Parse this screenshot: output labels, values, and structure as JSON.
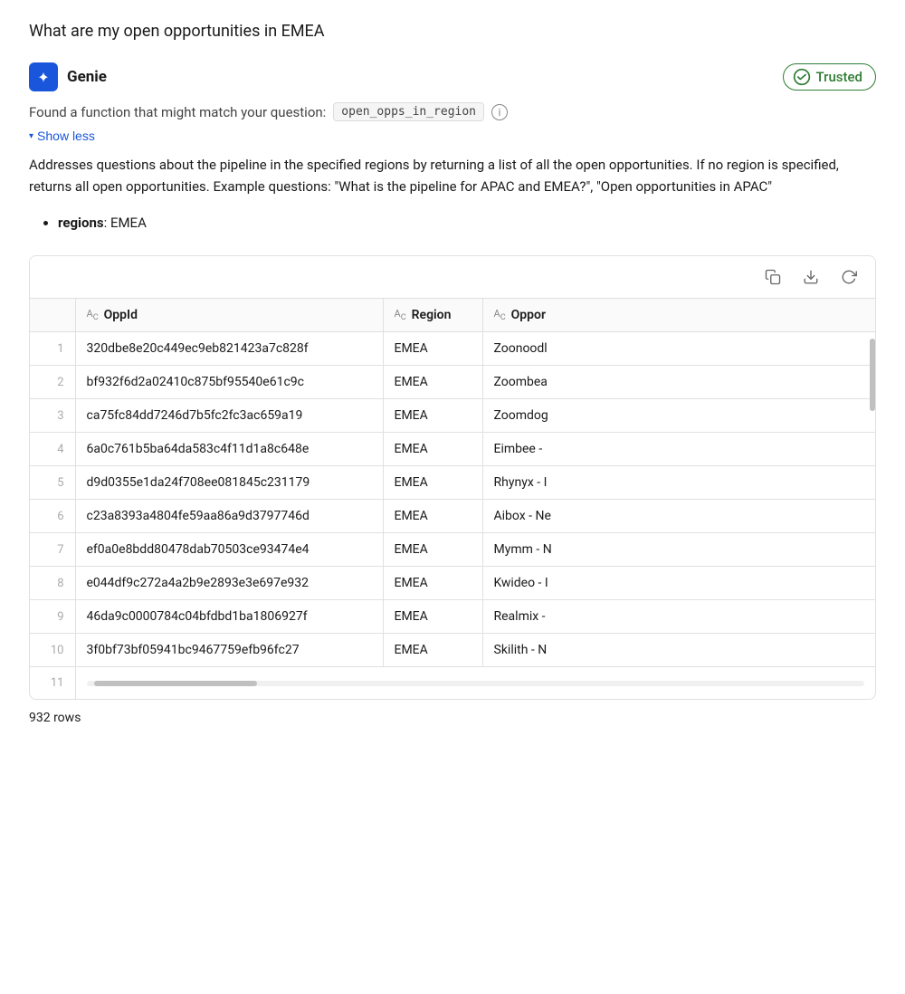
{
  "page": {
    "question": "What are my open opportunities in EMEA"
  },
  "genie": {
    "name": "Genie",
    "icon_symbol": "✦",
    "trusted_label": "Trusted",
    "function_found_text": "Found a function that might match your question:",
    "function_name": "open_opps_in_region",
    "show_less_label": "Show less",
    "description": "Addresses questions about the pipeline in the specified regions by returning a list of all the open opportunities. If no region is specified, returns all open opportunities. Example questions: \"What is the pipeline for APAC and EMEA?\", \"Open opportunities in APAC\"",
    "param_label": "regions",
    "param_value": "EMEA"
  },
  "toolbar": {
    "copy_icon": "⧉",
    "download_icon": "↓",
    "refresh_icon": "↺"
  },
  "table": {
    "columns": [
      {
        "id": "row_num",
        "label": ""
      },
      {
        "id": "oppid",
        "label": "OppId",
        "type": "ABC"
      },
      {
        "id": "region",
        "label": "Region",
        "type": "ABC"
      },
      {
        "id": "opporname",
        "label": "Oppor",
        "type": "ABC"
      }
    ],
    "rows": [
      {
        "num": "1",
        "oppid": "320dbe8e20c449ec9eb821423a7c828f",
        "region": "EMEA",
        "opporname": "Zoonoodl"
      },
      {
        "num": "2",
        "oppid": "bf932f6d2a02410c875bf95540e61c9c",
        "region": "EMEA",
        "opporname": "Zoombea"
      },
      {
        "num": "3",
        "oppid": "ca75fc84dd7246d7b5fc2fc3ac659a19",
        "region": "EMEA",
        "opporname": "Zoomdog"
      },
      {
        "num": "4",
        "oppid": "6a0c761b5ba64da583c4f11d1a8c648e",
        "region": "EMEA",
        "opporname": "Eimbee -"
      },
      {
        "num": "5",
        "oppid": "d9d0355e1da24f708ee081845c231179",
        "region": "EMEA",
        "opporname": "Rhynyx - I"
      },
      {
        "num": "6",
        "oppid": "c23a8393a4804fe59aa86a9d3797746d",
        "region": "EMEA",
        "opporname": "Aibox - Ne"
      },
      {
        "num": "7",
        "oppid": "ef0a0e8bdd80478dab70503ce93474e4",
        "region": "EMEA",
        "opporname": "Mymm - N"
      },
      {
        "num": "8",
        "oppid": "e044df9c272a4a2b9e2893e3e697e932",
        "region": "EMEA",
        "opporname": "Kwideo - I"
      },
      {
        "num": "9",
        "oppid": "46da9c0000784c04bfdbd1ba1806927f",
        "region": "EMEA",
        "opporname": "Realmix -"
      },
      {
        "num": "10",
        "oppid": "3f0bf73bf05941bc9467759efb96fc27",
        "region": "EMEA",
        "opporname": "Skilith - N"
      },
      {
        "num": "11",
        "oppid": "",
        "region": "",
        "opporname": ""
      }
    ],
    "rows_count": "932 rows"
  }
}
